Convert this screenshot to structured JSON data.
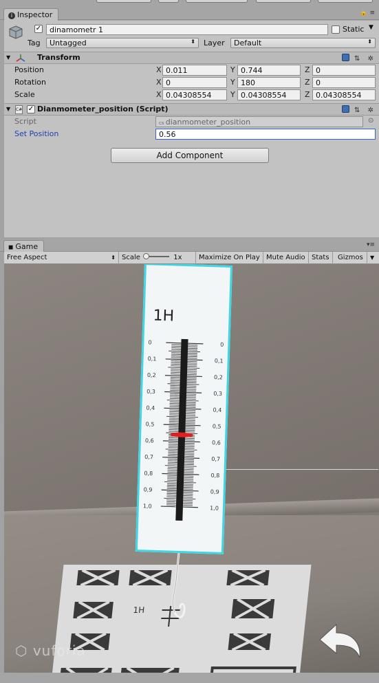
{
  "inspector": {
    "tab_label": "Inspector",
    "object_name": "dinamometr 1",
    "static_label": "Static",
    "tag_label": "Tag",
    "tag_value": "Untagged",
    "layer_label": "Layer",
    "layer_value": "Default"
  },
  "transform": {
    "title": "Transform",
    "rows": [
      {
        "label": "Position",
        "x": "0.011",
        "y": "0.744",
        "z": "0"
      },
      {
        "label": "Rotation",
        "x": "0",
        "y": "180",
        "z": "0"
      },
      {
        "label": "Scale",
        "x": "0.04308554",
        "y": "0.04308554",
        "z": "0.04308554"
      }
    ],
    "axis_x": "X",
    "axis_y": "Y",
    "axis_z": "Z"
  },
  "script_component": {
    "title": "Dianmometer_position (Script)",
    "script_label": "Script",
    "script_value": "dianmometer_position",
    "set_position_label": "Set Position",
    "set_position_value": "0.56"
  },
  "add_component_label": "Add Component",
  "game": {
    "tab_label": "Game",
    "aspect": "Free Aspect",
    "scale_label": "Scale",
    "scale_value": "1x",
    "maximize_label": "Maximize On Play",
    "mute_label": "Mute Audio",
    "stats_label": "Stats",
    "gizmos_label": "Gizmos",
    "scale_card_unit": "1H",
    "base_unit": "1H",
    "ticks": [
      "0",
      "0,1",
      "0,2",
      "0,3",
      "0,4",
      "0,5",
      "0,6",
      "0,7",
      "0,8",
      "0,9",
      "1,0"
    ],
    "indicator_value": 0.56,
    "brand_text": "vuforia"
  },
  "colors": {
    "panel_bg": "#c2c2c2",
    "card_border": "#3fd7e6",
    "indicator": "#e02020",
    "link_blue": "#1f3fb0"
  }
}
